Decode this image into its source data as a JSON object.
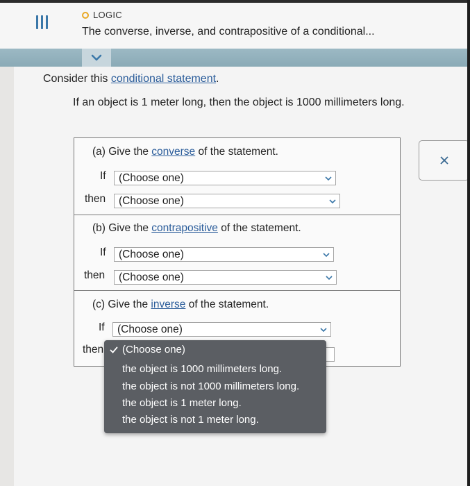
{
  "header": {
    "subject": "LOGIC",
    "title": "The converse, inverse, and contrapositive of a conditional..."
  },
  "intro": {
    "prefix": "Consider this ",
    "link": "conditional statement",
    "suffix": "."
  },
  "statement": "If an object is 1 meter long, then the object is 1000 millimeters long.",
  "questions": [
    {
      "prefix": "(a) Give the ",
      "link": "converse",
      "suffix": " of the statement.",
      "if_label": "If",
      "then_label": "then",
      "if_value": "(Choose one)",
      "then_value": "(Choose one)"
    },
    {
      "prefix": "(b) Give the ",
      "link": "contrapositive",
      "suffix": " of the statement.",
      "if_label": "If",
      "then_label": "then",
      "if_value": "(Choose one)",
      "then_value": "(Choose one)"
    },
    {
      "prefix": "(c) Give the ",
      "link": "inverse",
      "suffix": " of the statement.",
      "if_label": "If",
      "then_label": "then",
      "if_value": "(Choose one)"
    }
  ],
  "dropdown": {
    "options": [
      "(Choose one)",
      "the object is 1000 millimeters long.",
      "the object is not 1000 millimeters long.",
      "the object is 1 meter long.",
      "the object is not 1 meter long."
    ],
    "selected_index": 0
  },
  "icons": {
    "menu": "hamburger-menu-icon",
    "collapse": "chevron-down-icon",
    "close": "close-icon",
    "check": "checkmark-icon",
    "select_arrow": "chevron-down-icon"
  },
  "colors": {
    "link": "#2a5c9a",
    "accent_blue": "#3a77a8",
    "subject_dot": "#e9a824",
    "dropdown_bg": "#5b5e63"
  }
}
